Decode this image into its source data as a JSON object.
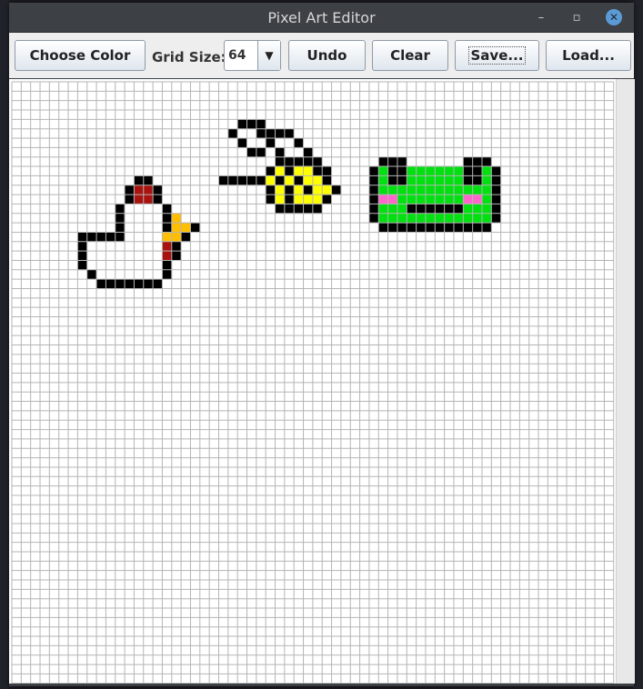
{
  "window": {
    "title": "Pixel Art Editor",
    "minimize_glyph": "–",
    "restore_glyph": "▫",
    "close_glyph": "✕"
  },
  "toolbar": {
    "choose_color_label": "Choose Color",
    "grid_size_label": "Grid Size:",
    "grid_size_value": "64",
    "grid_size_arrow": "▼",
    "undo_label": "Undo",
    "clear_label": "Clear",
    "save_label": "Save...",
    "load_label": "Load..."
  },
  "canvas": {
    "grid_size": 64,
    "grid_color": "#b5b5b5",
    "background": "#ffffff",
    "palette": {
      "K": "#000000",
      "W": "#ffffff",
      "R": "#a8130f",
      "O": "#ffbf00",
      "Y": "#ffff00",
      "G": "#00e10f",
      "P": "#ff66cc"
    },
    "sprites": [
      {
        "name": "chicken",
        "origin": [
          7,
          10
        ],
        "rows": [
          "......KK.....",
          ".....KRRK....",
          ".....KRRK....",
          "....KWWWWK...",
          "....KWWWWKO..",
          "....KWWWWKOOK",
          "KKKKKWWWWOOK.",
          "KWWWWWWWWRK..",
          "KWWWWWWWWRK..",
          "KWWWWWWWWK...",
          ".KWWWWWWWK...",
          "..KKKKKKK...."
        ]
      },
      {
        "name": "bee",
        "origin": [
          22,
          4
        ],
        "rows": [
          "..KKK.........",
          ".K..KKKK......",
          "..K..K..K.....",
          "...KK.K..K....",
          "......KKKKK...",
          ".....KYKYYKK..",
          "KKKKKYKYKYYK..",
          ".....KYKYKYYK.",
          ".....KYKYYYK..",
          "......KKKKK..."
        ]
      },
      {
        "name": "frog",
        "origin": [
          38,
          8
        ],
        "rows": [
          ".KKK......KKK.",
          "KGKKGGGGGGKKGK",
          "KGKKGGGGGGKKGK",
          "KGGGGGGGGGGGGK",
          "KPPGGGGGGGPPGK",
          "KGGGKKKKKKGGGK",
          "KGGGGGGGGGGGGK",
          ".KKKKKKKKKKKK."
        ]
      }
    ]
  }
}
